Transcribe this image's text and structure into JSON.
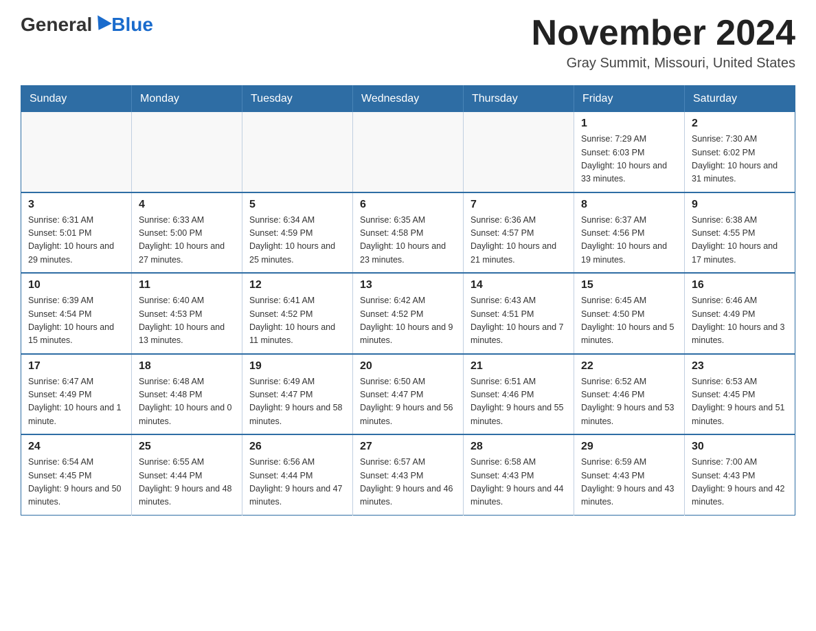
{
  "header": {
    "logo_general": "General",
    "logo_blue": "Blue",
    "month_title": "November 2024",
    "location": "Gray Summit, Missouri, United States"
  },
  "calendar": {
    "days_of_week": [
      "Sunday",
      "Monday",
      "Tuesday",
      "Wednesday",
      "Thursday",
      "Friday",
      "Saturday"
    ],
    "weeks": [
      [
        {
          "day": "",
          "info": ""
        },
        {
          "day": "",
          "info": ""
        },
        {
          "day": "",
          "info": ""
        },
        {
          "day": "",
          "info": ""
        },
        {
          "day": "",
          "info": ""
        },
        {
          "day": "1",
          "info": "Sunrise: 7:29 AM\nSunset: 6:03 PM\nDaylight: 10 hours\nand 33 minutes."
        },
        {
          "day": "2",
          "info": "Sunrise: 7:30 AM\nSunset: 6:02 PM\nDaylight: 10 hours\nand 31 minutes."
        }
      ],
      [
        {
          "day": "3",
          "info": "Sunrise: 6:31 AM\nSunset: 5:01 PM\nDaylight: 10 hours\nand 29 minutes."
        },
        {
          "day": "4",
          "info": "Sunrise: 6:33 AM\nSunset: 5:00 PM\nDaylight: 10 hours\nand 27 minutes."
        },
        {
          "day": "5",
          "info": "Sunrise: 6:34 AM\nSunset: 4:59 PM\nDaylight: 10 hours\nand 25 minutes."
        },
        {
          "day": "6",
          "info": "Sunrise: 6:35 AM\nSunset: 4:58 PM\nDaylight: 10 hours\nand 23 minutes."
        },
        {
          "day": "7",
          "info": "Sunrise: 6:36 AM\nSunset: 4:57 PM\nDaylight: 10 hours\nand 21 minutes."
        },
        {
          "day": "8",
          "info": "Sunrise: 6:37 AM\nSunset: 4:56 PM\nDaylight: 10 hours\nand 19 minutes."
        },
        {
          "day": "9",
          "info": "Sunrise: 6:38 AM\nSunset: 4:55 PM\nDaylight: 10 hours\nand 17 minutes."
        }
      ],
      [
        {
          "day": "10",
          "info": "Sunrise: 6:39 AM\nSunset: 4:54 PM\nDaylight: 10 hours\nand 15 minutes."
        },
        {
          "day": "11",
          "info": "Sunrise: 6:40 AM\nSunset: 4:53 PM\nDaylight: 10 hours\nand 13 minutes."
        },
        {
          "day": "12",
          "info": "Sunrise: 6:41 AM\nSunset: 4:52 PM\nDaylight: 10 hours\nand 11 minutes."
        },
        {
          "day": "13",
          "info": "Sunrise: 6:42 AM\nSunset: 4:52 PM\nDaylight: 10 hours\nand 9 minutes."
        },
        {
          "day": "14",
          "info": "Sunrise: 6:43 AM\nSunset: 4:51 PM\nDaylight: 10 hours\nand 7 minutes."
        },
        {
          "day": "15",
          "info": "Sunrise: 6:45 AM\nSunset: 4:50 PM\nDaylight: 10 hours\nand 5 minutes."
        },
        {
          "day": "16",
          "info": "Sunrise: 6:46 AM\nSunset: 4:49 PM\nDaylight: 10 hours\nand 3 minutes."
        }
      ],
      [
        {
          "day": "17",
          "info": "Sunrise: 6:47 AM\nSunset: 4:49 PM\nDaylight: 10 hours\nand 1 minute."
        },
        {
          "day": "18",
          "info": "Sunrise: 6:48 AM\nSunset: 4:48 PM\nDaylight: 10 hours\nand 0 minutes."
        },
        {
          "day": "19",
          "info": "Sunrise: 6:49 AM\nSunset: 4:47 PM\nDaylight: 9 hours\nand 58 minutes."
        },
        {
          "day": "20",
          "info": "Sunrise: 6:50 AM\nSunset: 4:47 PM\nDaylight: 9 hours\nand 56 minutes."
        },
        {
          "day": "21",
          "info": "Sunrise: 6:51 AM\nSunset: 4:46 PM\nDaylight: 9 hours\nand 55 minutes."
        },
        {
          "day": "22",
          "info": "Sunrise: 6:52 AM\nSunset: 4:46 PM\nDaylight: 9 hours\nand 53 minutes."
        },
        {
          "day": "23",
          "info": "Sunrise: 6:53 AM\nSunset: 4:45 PM\nDaylight: 9 hours\nand 51 minutes."
        }
      ],
      [
        {
          "day": "24",
          "info": "Sunrise: 6:54 AM\nSunset: 4:45 PM\nDaylight: 9 hours\nand 50 minutes."
        },
        {
          "day": "25",
          "info": "Sunrise: 6:55 AM\nSunset: 4:44 PM\nDaylight: 9 hours\nand 48 minutes."
        },
        {
          "day": "26",
          "info": "Sunrise: 6:56 AM\nSunset: 4:44 PM\nDaylight: 9 hours\nand 47 minutes."
        },
        {
          "day": "27",
          "info": "Sunrise: 6:57 AM\nSunset: 4:43 PM\nDaylight: 9 hours\nand 46 minutes."
        },
        {
          "day": "28",
          "info": "Sunrise: 6:58 AM\nSunset: 4:43 PM\nDaylight: 9 hours\nand 44 minutes."
        },
        {
          "day": "29",
          "info": "Sunrise: 6:59 AM\nSunset: 4:43 PM\nDaylight: 9 hours\nand 43 minutes."
        },
        {
          "day": "30",
          "info": "Sunrise: 7:00 AM\nSunset: 4:43 PM\nDaylight: 9 hours\nand 42 minutes."
        }
      ]
    ]
  }
}
